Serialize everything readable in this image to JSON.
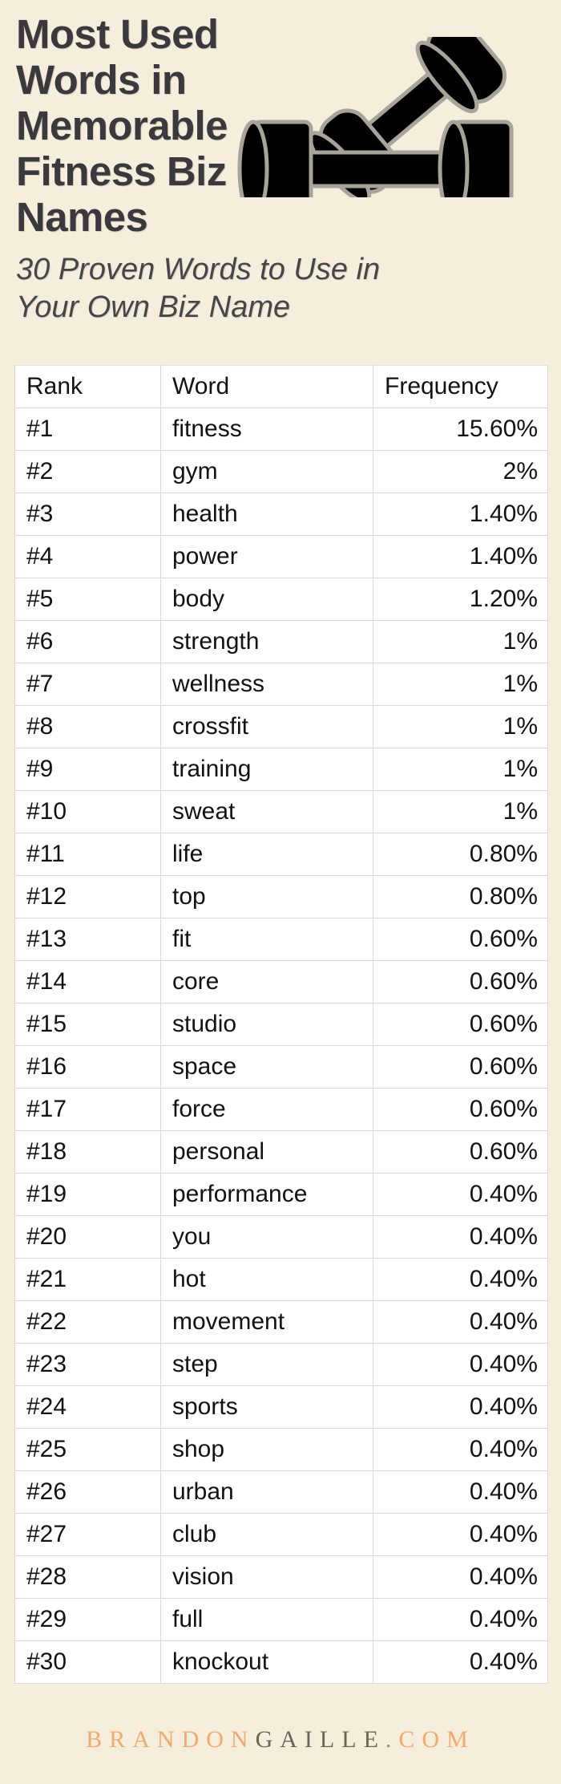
{
  "header": {
    "title": "Most Used Words in Memorable Fitness Biz Names",
    "subtitle": "30 Proven Words to Use in Your Own Biz Name",
    "art": "dumbbell-pair-icon"
  },
  "footer": {
    "brand_part1": "BRANDON",
    "brand_part2": "GAILLE",
    "brand_dot": ".",
    "brand_part3": "COM",
    "colors": {
      "orange": "#f2a96d",
      "gray": "#6b6558"
    }
  },
  "theme": {
    "background": "#f5eedd",
    "title_color": "#3a3a3e",
    "table_background": "#ffffff",
    "table_border": "#d8d8d8",
    "cell_text": "#121212"
  },
  "chart_data": {
    "type": "table",
    "title": "Most Used Words in Memorable Fitness Biz Names",
    "subtitle": "30 Proven Words to Use in Your Own Biz Name",
    "columns": [
      "Rank",
      "Word",
      "Frequency"
    ],
    "xlabel": "Word",
    "ylabel": "Frequency",
    "categories": [
      "fitness",
      "gym",
      "health",
      "power",
      "body",
      "strength",
      "wellness",
      "crossfit",
      "training",
      "sweat",
      "life",
      "top",
      "fit",
      "core",
      "studio",
      "space",
      "force",
      "personal",
      "performance",
      "you",
      "hot",
      "movement",
      "step",
      "sports",
      "shop",
      "urban",
      "club",
      "vision",
      "full",
      "knockout"
    ],
    "values": [
      15.6,
      2,
      1.4,
      1.4,
      1.2,
      1,
      1,
      1,
      1,
      1,
      0.8,
      0.8,
      0.6,
      0.6,
      0.6,
      0.6,
      0.6,
      0.6,
      0.4,
      0.4,
      0.4,
      0.4,
      0.4,
      0.4,
      0.4,
      0.4,
      0.4,
      0.4,
      0.4,
      0.4
    ],
    "rows": [
      {
        "rank": "#1",
        "word": "fitness",
        "frequency": "15.60%"
      },
      {
        "rank": "#2",
        "word": "gym",
        "frequency": "2%"
      },
      {
        "rank": "#3",
        "word": "health",
        "frequency": "1.40%"
      },
      {
        "rank": "#4",
        "word": "power",
        "frequency": "1.40%"
      },
      {
        "rank": "#5",
        "word": "body",
        "frequency": "1.20%"
      },
      {
        "rank": "#6",
        "word": "strength",
        "frequency": "1%"
      },
      {
        "rank": "#7",
        "word": "wellness",
        "frequency": "1%"
      },
      {
        "rank": "#8",
        "word": "crossfit",
        "frequency": "1%"
      },
      {
        "rank": "#9",
        "word": "training",
        "frequency": "1%"
      },
      {
        "rank": "#10",
        "word": "sweat",
        "frequency": "1%"
      },
      {
        "rank": "#11",
        "word": "life",
        "frequency": "0.80%"
      },
      {
        "rank": "#12",
        "word": "top",
        "frequency": "0.80%"
      },
      {
        "rank": "#13",
        "word": "fit",
        "frequency": "0.60%"
      },
      {
        "rank": "#14",
        "word": "core",
        "frequency": "0.60%"
      },
      {
        "rank": "#15",
        "word": "studio",
        "frequency": "0.60%"
      },
      {
        "rank": "#16",
        "word": "space",
        "frequency": "0.60%"
      },
      {
        "rank": "#17",
        "word": "force",
        "frequency": "0.60%"
      },
      {
        "rank": "#18",
        "word": "personal",
        "frequency": "0.60%"
      },
      {
        "rank": "#19",
        "word": "performance",
        "frequency": "0.40%"
      },
      {
        "rank": "#20",
        "word": "you",
        "frequency": "0.40%"
      },
      {
        "rank": "#21",
        "word": "hot",
        "frequency": "0.40%"
      },
      {
        "rank": "#22",
        "word": "movement",
        "frequency": "0.40%"
      },
      {
        "rank": "#23",
        "word": "step",
        "frequency": "0.40%"
      },
      {
        "rank": "#24",
        "word": "sports",
        "frequency": "0.40%"
      },
      {
        "rank": "#25",
        "word": "shop",
        "frequency": "0.40%"
      },
      {
        "rank": "#26",
        "word": "urban",
        "frequency": "0.40%"
      },
      {
        "rank": "#27",
        "word": "club",
        "frequency": "0.40%"
      },
      {
        "rank": "#28",
        "word": "vision",
        "frequency": "0.40%"
      },
      {
        "rank": "#29",
        "word": "full",
        "frequency": "0.40%"
      },
      {
        "rank": "#30",
        "word": "knockout",
        "frequency": "0.40%"
      }
    ]
  }
}
